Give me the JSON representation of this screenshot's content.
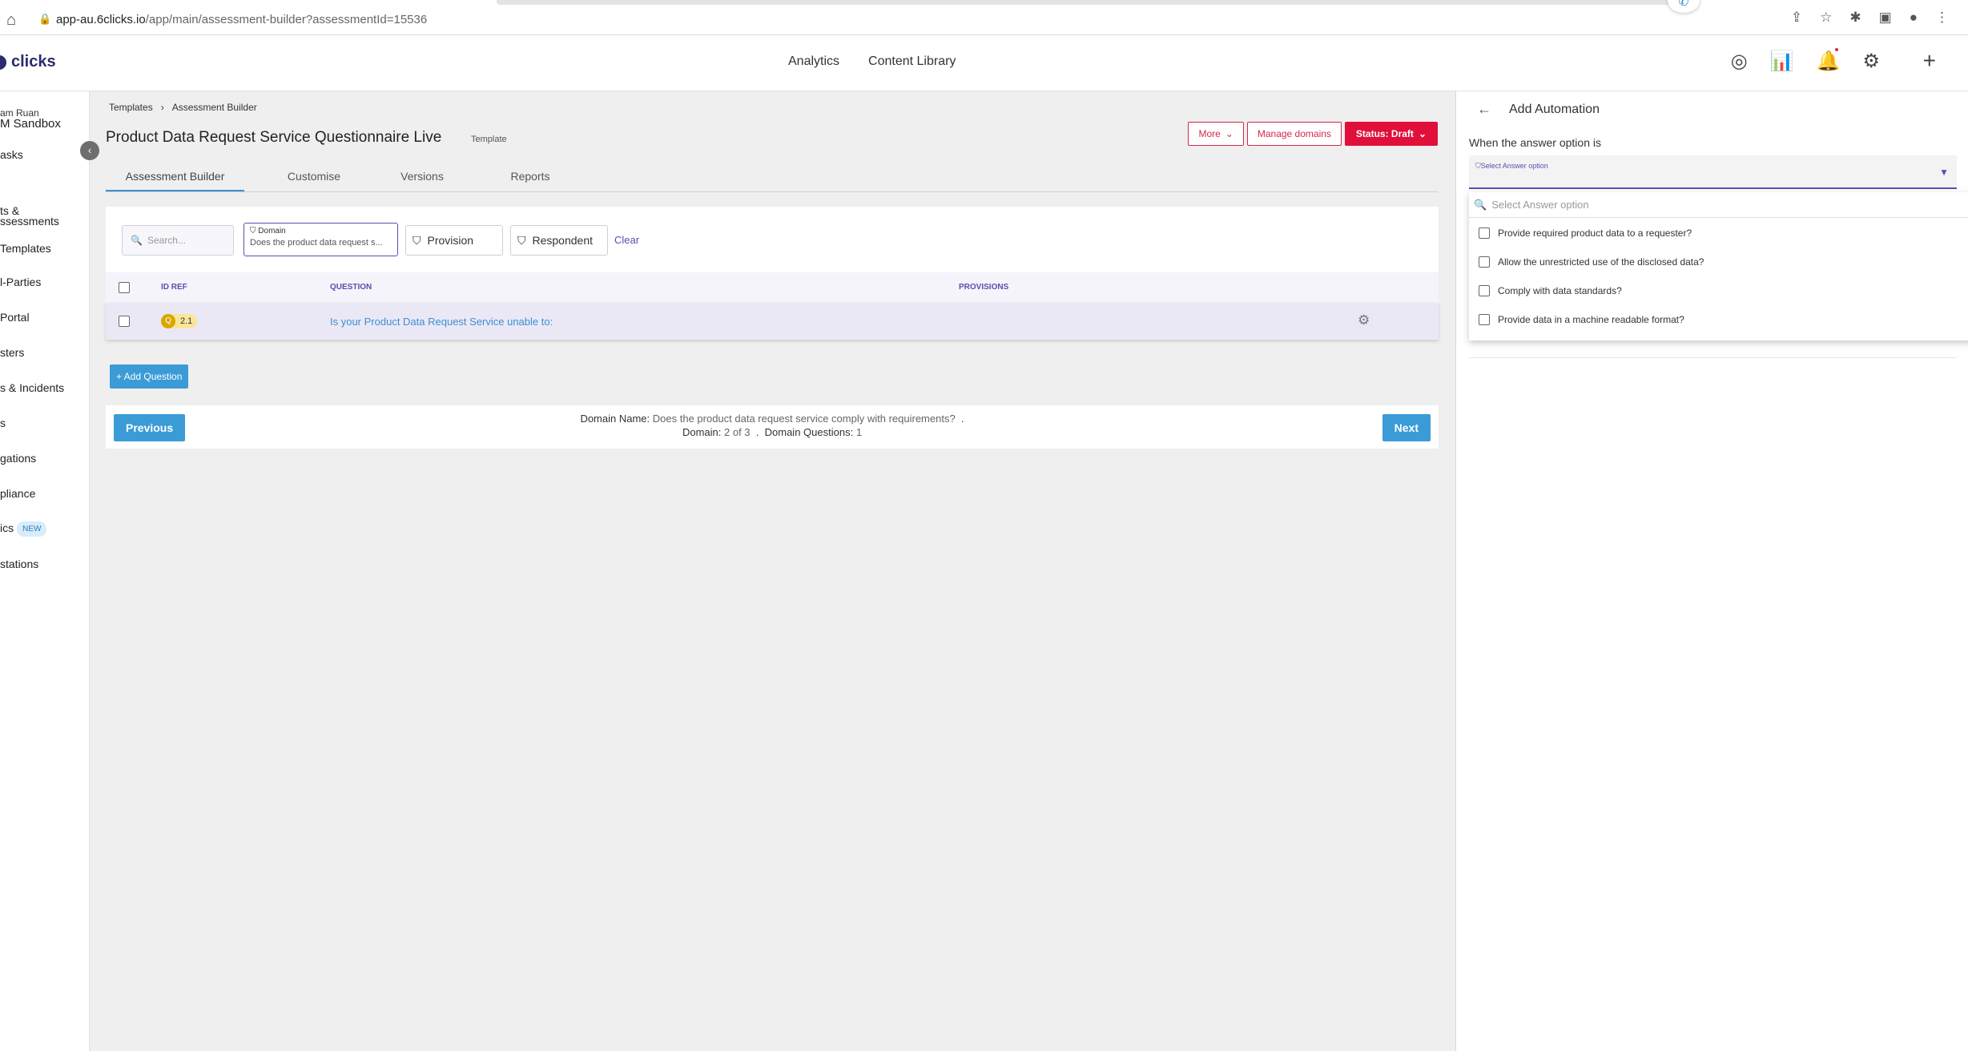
{
  "browser": {
    "url_host": "app-au.6clicks.io",
    "url_path": "/app/main/assessment-builder?assessmentId=15536"
  },
  "header": {
    "logo_text": "clicks",
    "nav": [
      "Analytics",
      "Content Library"
    ]
  },
  "sidebar": {
    "user_name": "am Ruan",
    "org_name": "M Sandbox",
    "items": [
      "asks",
      "ts &",
      "ssessments",
      "Templates",
      "l-Parties",
      "Portal",
      "sters",
      "s & Incidents",
      "s",
      "gations",
      "pliance",
      "ics",
      "stations"
    ],
    "new_badge": "NEW"
  },
  "breadcrumb": [
    "Templates",
    "Assessment Builder"
  ],
  "page": {
    "title": "Product Data Request Service Questionnaire Live",
    "tag": "Template",
    "more_label": "More",
    "manage_domains_label": "Manage domains",
    "status_label": "Status: Draft"
  },
  "tabs": [
    "Assessment Builder",
    "Customise",
    "Versions",
    "Reports"
  ],
  "filters": {
    "search_placeholder": "Search...",
    "domain_label": "Domain",
    "domain_value": "Does the product data request s...",
    "provision_label": "Provision",
    "respondent_label": "Respondent",
    "clear_label": "Clear"
  },
  "table": {
    "headers": [
      "ID REF",
      "QUESTION",
      "PROVISIONS"
    ],
    "rows": [
      {
        "badge": "Q",
        "id": "2.1",
        "question": "Is your Product Data Request Service unable to:"
      }
    ]
  },
  "add_question_label": "+ Add Question",
  "pager": {
    "previous_label": "Previous",
    "next_label": "Next",
    "domain_name_label": "Domain Name:",
    "domain_name_value": "Does the product data request service comply with requirements?",
    "sep": ".",
    "domain_label": "Domain:",
    "domain_value": "2 of 3",
    "domain_questions_label": "Domain Questions:",
    "domain_questions_value": "1"
  },
  "automation_panel": {
    "title": "Add Automation",
    "field_label": "When the answer option is",
    "select_placeholder": "Select Answer option",
    "search_placeholder": "Select Answer option",
    "options": [
      "Provide required product data to a requester?",
      "Allow the unrestricted use of the disclosed data?",
      "Comply with data standards?",
      "Provide data in a machine readable format?"
    ]
  },
  "colors": {
    "accent_purple": "#5a4fb0",
    "primary_blue": "#3b9bd6",
    "status_red": "#e0103a"
  }
}
